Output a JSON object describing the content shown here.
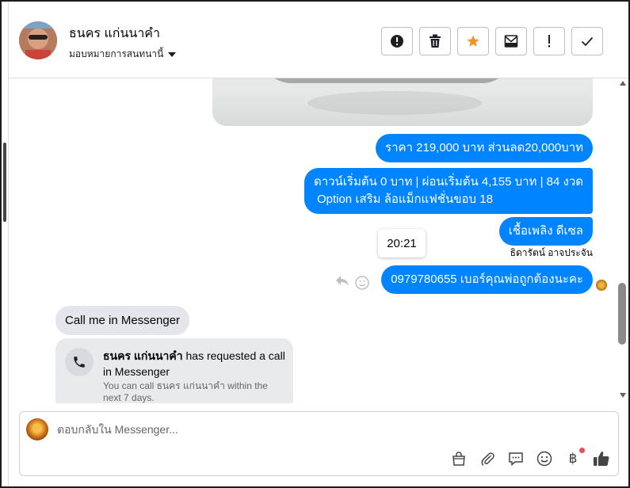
{
  "header": {
    "contact_name": "ธนคร แก่นนาคำ",
    "assign_label": "มอบหมายการสนทนานี้",
    "actions": [
      {
        "name": "mark-spam-button",
        "icon": "alert-circle-icon"
      },
      {
        "name": "delete-button",
        "icon": "trash-icon"
      },
      {
        "name": "star-button",
        "icon": "star-icon"
      },
      {
        "name": "mark-unread-button",
        "icon": "mail-icon"
      },
      {
        "name": "follow-up-button",
        "icon": "exclamation-icon"
      },
      {
        "name": "done-button",
        "icon": "check-icon"
      }
    ]
  },
  "messages": {
    "price": "ราคา 219,000 บาท ส่วนลด20,000บาท",
    "terms_line1": "ดาวน์เริ่มต้น 0 บาท | ผ่อนเริ่มต้น 4,155 บาท | 84 งวด",
    "terms_line2": "Option เสริม ล้อแม็กแฟชั่นขอบ 18",
    "fuel": "เชื้อเพลิง ดีเซล",
    "timestamp": "20:21",
    "sender_name": "ธิดารัตน์ อาจประจัน",
    "phone": "0979780655 เบอร์คุณพ่อถูกต้องนะคะ",
    "incoming": "Call me in Messenger",
    "call_title_name": "ธนคร แก่นนาคำ",
    "call_title_rest": "has requested a call in Messenger",
    "call_desc": "You can call ธนคร แก่นนาคำ within the next 7 days."
  },
  "composer": {
    "placeholder": "ตอบกลับใน Messenger..."
  },
  "colors": {
    "outgoing_bubble": "#0084ff",
    "incoming_bubble": "#e4e6eb",
    "star": "#f0932b",
    "notification_dot": "#e8505b"
  }
}
